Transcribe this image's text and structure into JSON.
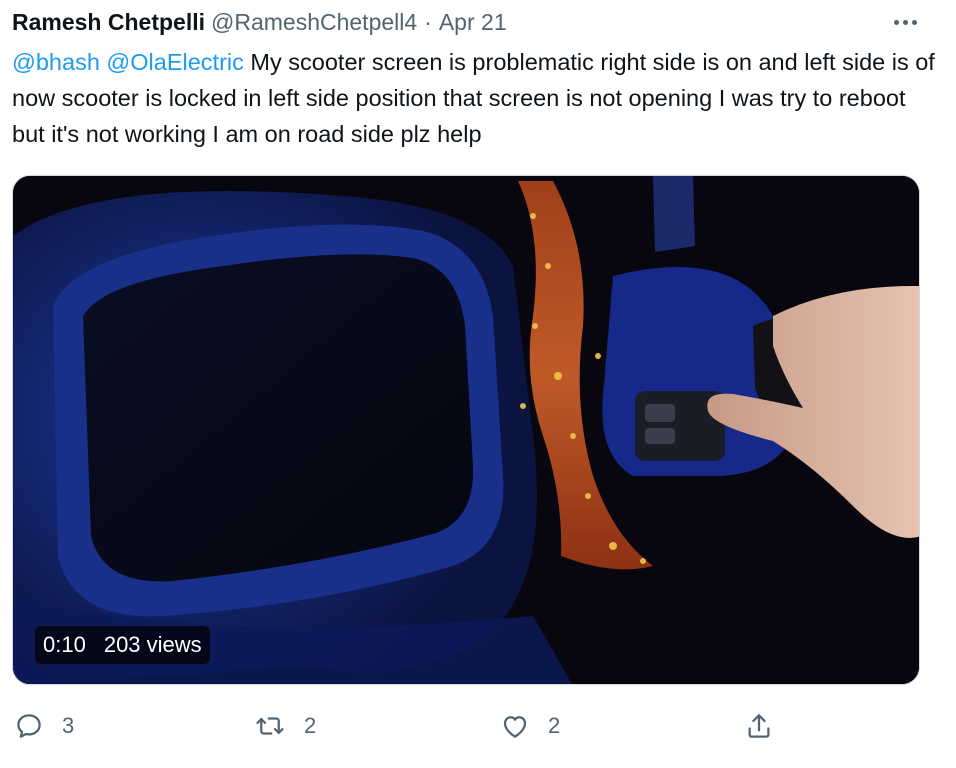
{
  "tweet": {
    "author_name": "Ramesh Chetpelli",
    "author_handle": "@RameshChetpell4",
    "separator": "·",
    "date": "Apr 21",
    "mentions": [
      "@bhash",
      "@OlaElectric"
    ],
    "text": "My scooter screen is problematic right side is on and left side is of now scooter is locked in left side position that screen is not opening I was try to reboot but it's not working I am on road side plz help"
  },
  "video": {
    "duration": "0:10",
    "views": "203 views"
  },
  "actions": {
    "reply_count": "3",
    "retweet_count": "2",
    "like_count": "2"
  },
  "icons": {
    "more": "more-horizontal-icon",
    "reply": "reply-bubble-icon",
    "retweet": "retweet-arrows-icon",
    "like": "heart-icon",
    "share": "share-upload-icon"
  },
  "colors": {
    "link": "#1d9bf0",
    "secondary_text": "#536471",
    "primary_text": "#0f1419"
  }
}
